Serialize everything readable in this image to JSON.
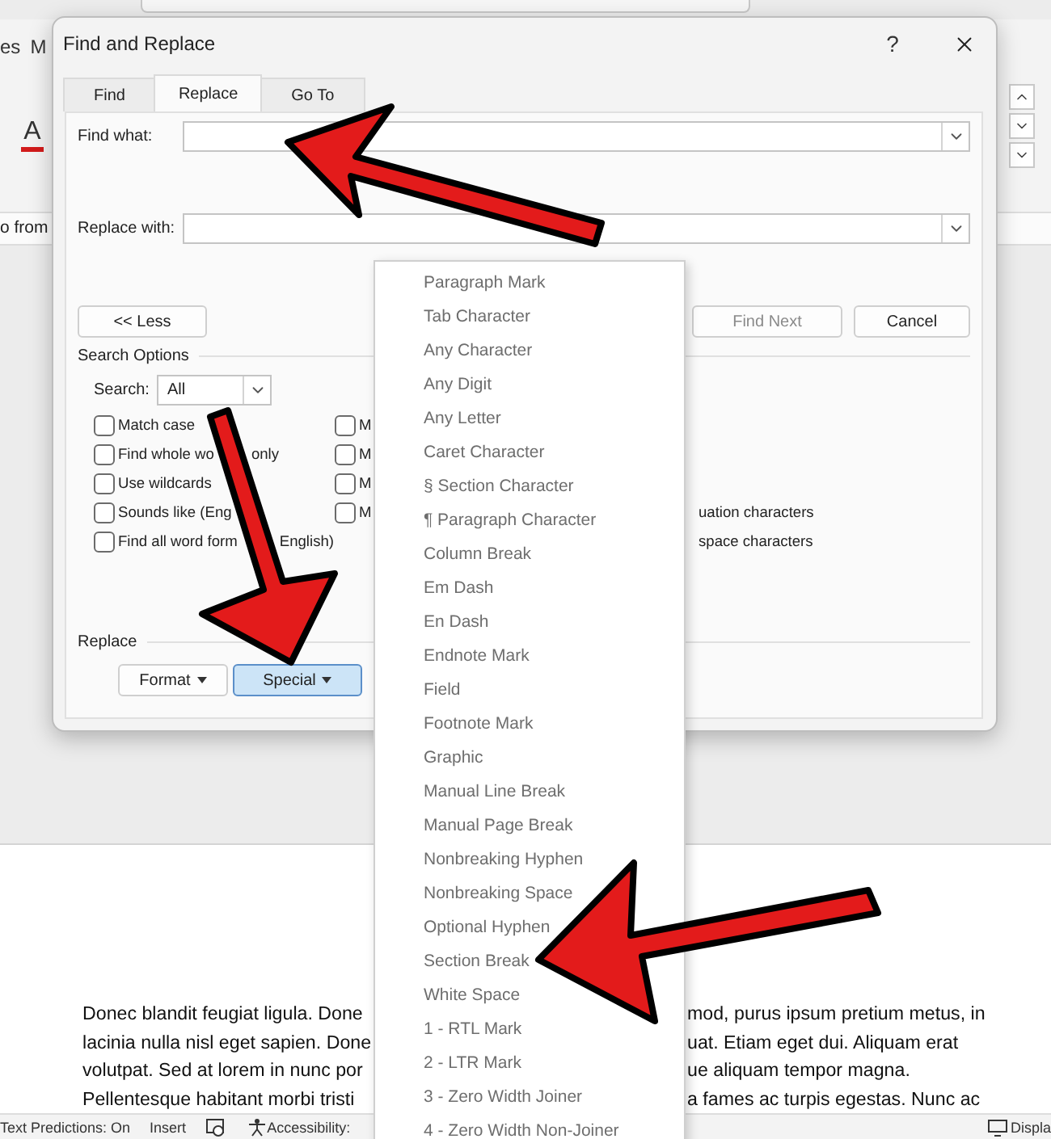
{
  "word": {
    "ribbon_tabs": [
      "es",
      "M"
    ],
    "font_color_glyph": "A",
    "bar_text": "o from",
    "document_lines": [
      {
        "left": "Donec blandit feugiat ligula. Done",
        "right": "mod, purus ipsum pretium metus, in"
      },
      {
        "left": "lacinia nulla nisl eget sapien. Done",
        "right": "uat. Etiam eget dui. Aliquam erat"
      },
      {
        "left": "volutpat. Sed at lorem in nunc por",
        "right": "ue aliquam tempor magna."
      },
      {
        "left": "Pellentesque habitant morbi tristi",
        "right": "a fames ac turpis egestas. Nunc ac"
      }
    ],
    "status_bar": {
      "predictions": "Text Predictions: On",
      "mode": "Insert",
      "accessibility": "Accessibility:",
      "display": "Displa"
    }
  },
  "dialog": {
    "title": "Find and Replace",
    "help": "?",
    "tabs": [
      {
        "label": "Find",
        "selected": false
      },
      {
        "label": "Replace",
        "selected": true
      },
      {
        "label": "Go To",
        "selected": false
      }
    ],
    "find_label": "Find what:",
    "replace_label": "Replace with:",
    "less_button": "<< Less",
    "find_next": {
      "label": "Find Next",
      "disabled": true
    },
    "cancel": "Cancel",
    "search_options": "Search Options",
    "search_label": "Search:",
    "search_value": "All",
    "options": [
      {
        "label": "Match case",
        "checked": false
      },
      {
        "label": "Find whole wo",
        "label_end": "only",
        "checked": false
      },
      {
        "label": "Use wildcards",
        "checked": false
      },
      {
        "label": "Sounds like (Eng",
        "checked": false
      },
      {
        "label": "Find all word form",
        "label_end": "English)",
        "checked": false
      }
    ],
    "options_right": [
      {
        "label": "M",
        "checked": false
      },
      {
        "label": "M",
        "checked": false
      },
      {
        "label": "M",
        "checked": false
      },
      {
        "label": "M",
        "checked": false
      }
    ],
    "options_partial": [
      "uation characters",
      "space characters"
    ],
    "replace_section": "Replace",
    "format_button": "Format",
    "special_button": {
      "label": "Special",
      "pressed": true
    }
  },
  "special_menu": {
    "items": [
      "Paragraph Mark",
      "Tab Character",
      "Any Character",
      "Any Digit",
      "Any Letter",
      "Caret Character",
      "§ Section Character",
      "¶ Paragraph Character",
      "Column Break",
      "Em Dash",
      "En Dash",
      "Endnote Mark",
      "Field",
      "Footnote Mark",
      "Graphic",
      "Manual Line Break",
      "Manual Page Break",
      "Nonbreaking Hyphen",
      "Nonbreaking Space",
      "Optional Hyphen",
      "Section Break",
      "White Space",
      "1 - RTL Mark",
      "2 - LTR Mark",
      "3 - Zero Width Joiner",
      "4 - Zero Width Non-Joiner"
    ]
  }
}
